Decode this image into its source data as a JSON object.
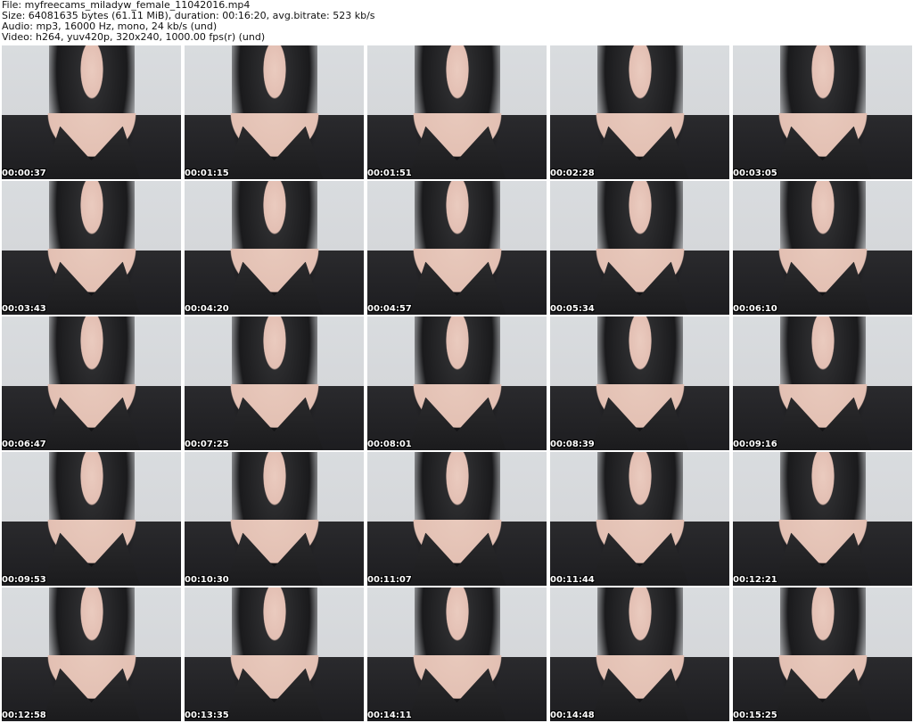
{
  "header": {
    "file_line": "File: myfreecams_miladyw_female_11042016.mp4",
    "size_line": "Size: 64081635 bytes (61.11 MiB), duration: 00:16:20, avg.bitrate: 523 kb/s",
    "audio_line": "Audio: mp3, 16000 Hz, mono, 24 kb/s (und)",
    "video_line": "Video: h264, yuv420p, 320x240, 1000.00 fps(r) (und)"
  },
  "thumbnails": [
    {
      "timestamp": "00:00:37"
    },
    {
      "timestamp": "00:01:15"
    },
    {
      "timestamp": "00:01:51"
    },
    {
      "timestamp": "00:02:28"
    },
    {
      "timestamp": "00:03:05"
    },
    {
      "timestamp": "00:03:43"
    },
    {
      "timestamp": "00:04:20"
    },
    {
      "timestamp": "00:04:57"
    },
    {
      "timestamp": "00:05:34"
    },
    {
      "timestamp": "00:06:10"
    },
    {
      "timestamp": "00:06:47"
    },
    {
      "timestamp": "00:07:25"
    },
    {
      "timestamp": "00:08:01"
    },
    {
      "timestamp": "00:08:39"
    },
    {
      "timestamp": "00:09:16"
    },
    {
      "timestamp": "00:09:53"
    },
    {
      "timestamp": "00:10:30"
    },
    {
      "timestamp": "00:11:07"
    },
    {
      "timestamp": "00:11:44"
    },
    {
      "timestamp": "00:12:21"
    },
    {
      "timestamp": "00:12:58"
    },
    {
      "timestamp": "00:13:35"
    },
    {
      "timestamp": "00:14:11"
    },
    {
      "timestamp": "00:14:48"
    },
    {
      "timestamp": "00:15:25"
    }
  ]
}
